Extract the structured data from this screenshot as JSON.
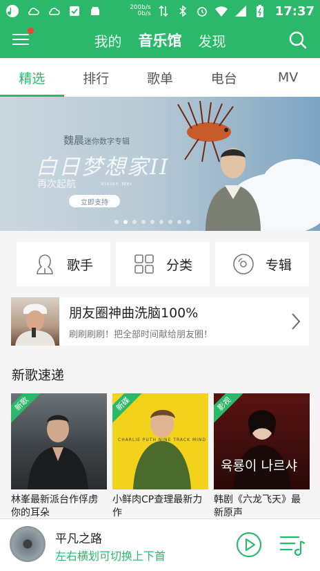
{
  "status_bar": {
    "net_speed_up": "200b/s",
    "net_speed_down": "0b/s",
    "time": "17:37",
    "icons": [
      "app-logo-icon",
      "cloud-icon",
      "cloud-outline-icon",
      "security-icon",
      "android-icon",
      "data-arrows-icon",
      "bluetooth-icon",
      "alarm-icon",
      "wifi-icon",
      "signal-icon",
      "battery-icon"
    ]
  },
  "header": {
    "tabs": [
      {
        "label": "我的"
      },
      {
        "label": "音乐馆"
      },
      {
        "label": "发现"
      }
    ],
    "active_tab": "音乐馆"
  },
  "subtabs": [
    {
      "label": "精选"
    },
    {
      "label": "排行"
    },
    {
      "label": "歌单"
    },
    {
      "label": "电台"
    },
    {
      "label": "MV"
    }
  ],
  "banner": {
    "artist": "魏晨",
    "artist_suffix": "迷你数字专辑",
    "title": "白日梦想家II",
    "subtitle": "再次起航",
    "english": "Vision Wei",
    "cta": "立即支持",
    "dots_count": 9,
    "active_dot": 1
  },
  "categories": [
    {
      "label": "歌手",
      "icon": "singer-icon"
    },
    {
      "label": "分类",
      "icon": "grid-icon"
    },
    {
      "label": "专辑",
      "icon": "album-icon"
    }
  ],
  "promo": {
    "title": "朋友圈神曲洗脑100%",
    "subtitle": "刷刷刷刷！把全部时间献给朋友圈！"
  },
  "new_songs": {
    "section_title": "新歌速递",
    "cards": [
      {
        "badge": "新歌",
        "title": "林峯最新派台作俘虏你的耳朵"
      },
      {
        "badge": "新碟",
        "title": "小鲜肉CP查理最新力作",
        "cover_text": "CHARLIE PUTH NINE TRACK MIND"
      },
      {
        "badge": "影视",
        "title": "韩剧《六龙飞天》最新原声",
        "cover_text": "육룡이 나르샤"
      }
    ]
  },
  "player": {
    "song": "平凡之路",
    "hint": "左右横划可切换上下首"
  },
  "colors": {
    "brand_green": "#2cb86a",
    "notification_red": "#ff3b30"
  }
}
